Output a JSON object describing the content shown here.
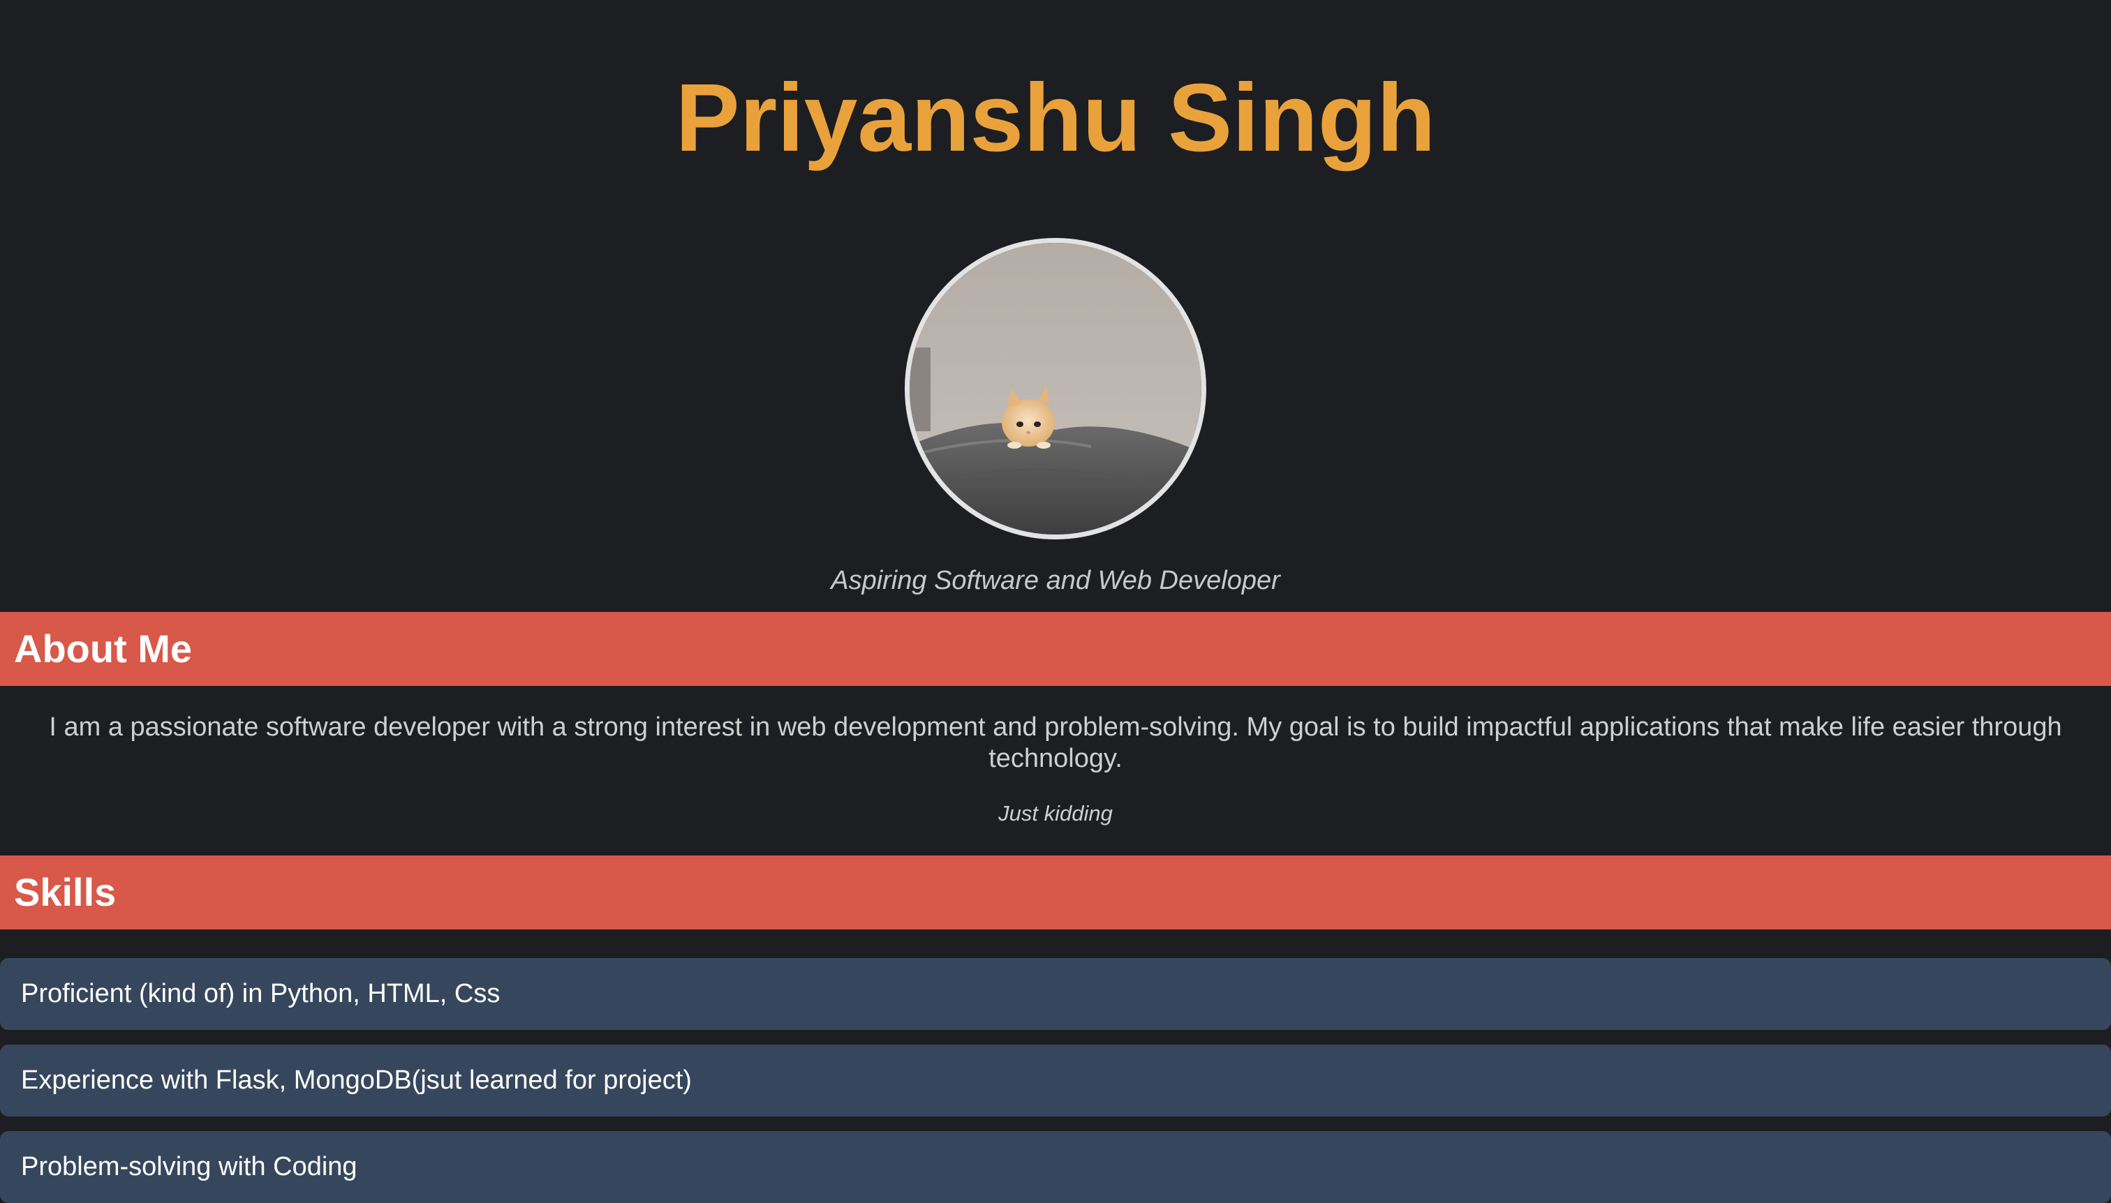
{
  "profile": {
    "name": "Priyanshu Singh",
    "tagline": "Aspiring Software and Web Developer",
    "avatar_icon": "kitten-photo"
  },
  "about": {
    "heading": "About Me",
    "text": "I am a passionate software developer with a strong interest in web development and problem-solving. My goal is to build impactful applications that make life easier through technology.",
    "note": "Just kidding"
  },
  "skills": {
    "heading": "Skills",
    "items": [
      "Proficient (kind of) in Python, HTML, Css",
      "Experience with Flask, MongoDB(jsut learned for project)",
      "Problem-solving with Coding"
    ]
  },
  "colors": {
    "background": "#1d1e22",
    "name": "#e9a23b",
    "section_header": "#d85849",
    "skill_card": "#36475d"
  }
}
